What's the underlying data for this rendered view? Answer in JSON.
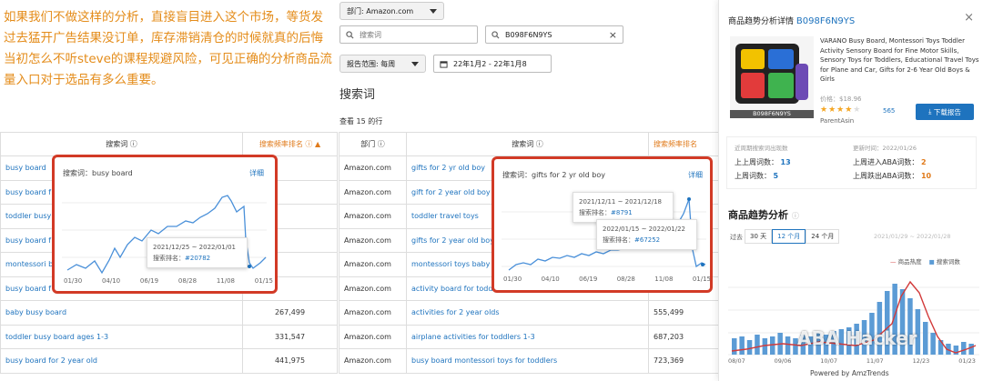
{
  "note": {
    "text": "如果我们不做这样的分析，直接盲目进入这个市场，等货发过去猛开广告结果没订单，库存滞销清仓的时候就真的后悔当初怎么不听steve的课程规避风险，可见正确的分析商品流量入口对于选品有多么重要。"
  },
  "filters": {
    "department": "部门: Amazon.com",
    "search_placeholder": "搜索词",
    "asin_value": "B098F6N9YS",
    "clear": "×",
    "report_range": "报告范围: 每周",
    "date_range": "22年1月2 - 22年1月8"
  },
  "section": {
    "title": "搜索词",
    "count": "查看 15 的行"
  },
  "left_table": {
    "headers": [
      "搜索词 ⓘ",
      "搜索频率排名 ⓘ ▲"
    ],
    "rows": [
      [
        "busy board",
        ""
      ],
      [
        "busy board f",
        ""
      ],
      [
        "toddler busy",
        ""
      ],
      [
        "busy board f",
        ""
      ],
      [
        "montessori b",
        ""
      ],
      [
        "busy board f",
        ""
      ],
      [
        "baby busy board",
        "267,499"
      ],
      [
        "toddler busy board ages 1-3",
        "331,547"
      ],
      [
        "busy board for 2 year old",
        "441,975"
      ]
    ]
  },
  "right_table": {
    "headers": [
      "部门 ⓘ",
      "搜索词 ⓘ",
      "搜索频率排名"
    ],
    "rows": [
      [
        "Amazon.com",
        "gifts for 2 yr old boy",
        ""
      ],
      [
        "Amazon.com",
        "gift for 2 year old boy",
        ""
      ],
      [
        "Amazon.com",
        "toddler travel toys",
        ""
      ],
      [
        "Amazon.com",
        "gifts for 2 year old boy",
        ""
      ],
      [
        "Amazon.com",
        "montessori toys baby 1",
        ""
      ],
      [
        "Amazon.com",
        "activity board for toddl",
        ""
      ],
      [
        "Amazon.com",
        "activities for 2 year olds",
        "555,499"
      ],
      [
        "Amazon.com",
        "airplane activities for toddlers 1-3",
        "687,203"
      ],
      [
        "Amazon.com",
        "busy board montessori toys for toddlers",
        "723,369"
      ]
    ]
  },
  "popup1": {
    "title": "搜索词：busy board",
    "detail": "详细",
    "ticks": [
      "01/30",
      "04/10",
      "06/19",
      "08/28",
      "11/08",
      "01/15"
    ],
    "tip_date": "2021/12/25 ~ 2022/01/01",
    "tip_label": "搜索排名：",
    "tip_value": "#20782"
  },
  "popup2": {
    "title": "搜索词：gifts for 2 yr old boy",
    "detail": "详细",
    "ticks": [
      "01/30",
      "04/10",
      "06/19",
      "08/28",
      "11/08",
      "01/15"
    ],
    "tip1_date": "2021/12/11 ~ 2021/12/18",
    "tip1_label": "搜索排名：",
    "tip1_value": "#8791",
    "tip2_date": "2022/01/15 ~ 2022/01/22",
    "tip2_label": "搜索排名：",
    "tip2_value": "#67252"
  },
  "panel": {
    "title": "商品趋势分析详情",
    "asin": "B098F6N9YS",
    "close": "×",
    "product_title": "VARANO Busy Board, Montessori Toys Toddler Activity Sensory Board for Fine Motor Skills, Sensory Toys for Toddlers, Educational Travel Toys for Plane and Car, Gifts for 2-6 Year Old Boys & Girls",
    "price": "价格：$18.96",
    "reviews": "565",
    "parent": "ParentAsin",
    "image_caption": "B098F6N9YS",
    "download": "下载报告",
    "stats_header1": "近周期搜索词出现数",
    "stats_header2": "更新时间：2022/01/26",
    "s1_label": "上上周词数：",
    "s1_value": "13",
    "s2_label": "上周词数：",
    "s2_value": "5",
    "s3_label": "上周进入ABA词数：",
    "s3_value": "2",
    "s4_label": "上周跌出ABA词数：",
    "s4_value": "10",
    "trend_title": "商品趋势分析",
    "range_label": "过去",
    "range_opts": [
      "30 天",
      "12 个月",
      "24 个月"
    ],
    "range_dates": "2021/01/29 ~ 2022/01/28",
    "legend1": "商品热度",
    "legend2": "搜索词数",
    "x_ticks": [
      "08/07",
      "09/06",
      "10/07",
      "11/07",
      "12/23",
      "01/23"
    ],
    "powered": "Powered by AmzTrends",
    "watermark": "ABA Hacker"
  },
  "colors": {
    "accent": "#1e73be",
    "orange": "#e48c1a",
    "popup_border": "#d23a26",
    "bar": "#5b9bd5",
    "line": "#d23a3a"
  }
}
